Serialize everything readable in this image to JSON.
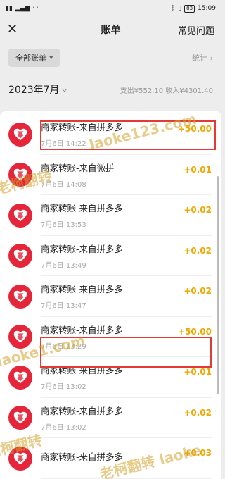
{
  "status": {
    "time": "15:09",
    "battery": "83"
  },
  "nav": {
    "title": "账单",
    "faq": "常见问题"
  },
  "filter": {
    "label": "全部账单",
    "stats": "统计 ›"
  },
  "month": {
    "label": "2023年7月",
    "totals": "支出¥552.10  收入¥4301.40"
  },
  "transactions": [
    {
      "title": "商家转账-来自拼多多",
      "time": "7月6日 14:22",
      "amount": "+50.00"
    },
    {
      "title": "商家转账-来自微拼",
      "time": "7月6日 14:08",
      "amount": "+0.01"
    },
    {
      "title": "商家转账-来自拼多多",
      "time": "7月6日 13:53",
      "amount": "+0.02"
    },
    {
      "title": "商家转账-来自拼多多",
      "time": "7月6日 13:49",
      "amount": "+0.02"
    },
    {
      "title": "商家转账-来自拼多多",
      "time": "7月6日 13:47",
      "amount": "+0.02"
    },
    {
      "title": "商家转账-来自拼多多",
      "time": "7月6日 13:29",
      "amount": "+50.00"
    },
    {
      "title": "商家转账-来自拼多多",
      "time": "7月6日 13:02",
      "amount": "+0.01"
    },
    {
      "title": "商家转账-来自拼多多",
      "time": "7月6日 13:02",
      "amount": "+0.02"
    },
    {
      "title": "商家转账-来自拼多多",
      "time": "",
      "amount": "+0.03"
    }
  ],
  "watermarks": [
    "laoke123.com",
    "老柯翻转",
    "老柯翻转 laoke",
    "laoke1.com",
    "老柯翻转"
  ],
  "colors": {
    "amount": "#f0a800",
    "logo": "#e5253a",
    "highlight": "#e53935"
  }
}
